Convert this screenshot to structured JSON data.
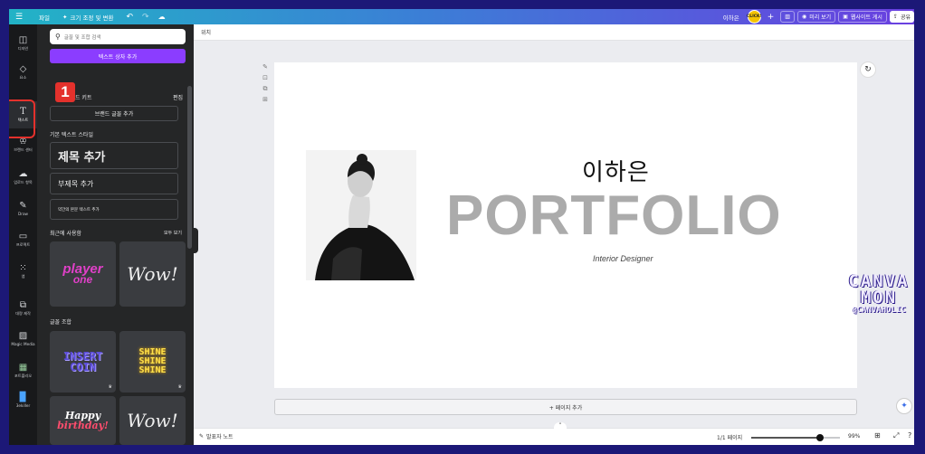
{
  "topbar": {
    "menu_icon": "hamburger-icon",
    "file": "파일",
    "resize": "크기 조정 및 변환",
    "undo_icon": "undo-icon",
    "redo_icon": "redo-icon",
    "cloud_icon": "cloud-icon",
    "user_name": "이하은",
    "avatar_text": "CLICK!",
    "add": "+",
    "stats_icon": "chart-icon",
    "preview": "미리 보기",
    "publish": "웹사이트 게시",
    "share": "공유"
  },
  "rail": [
    {
      "label": "디자인",
      "icon": "design-icon"
    },
    {
      "label": "요소",
      "icon": "elements-icon"
    },
    {
      "label": "텍스트",
      "icon": "text-icon"
    },
    {
      "label": "브랜드 센터",
      "icon": "brand-icon"
    },
    {
      "label": "업로드 항목",
      "icon": "upload-icon"
    },
    {
      "label": "Draw",
      "icon": "draw-icon"
    },
    {
      "label": "프로젝트",
      "icon": "folder-icon"
    },
    {
      "label": "앱",
      "icon": "apps-icon"
    },
    {
      "label": "대량 제작",
      "icon": "bulk-create-icon"
    },
    {
      "label": "Magic Media",
      "icon": "magic-media-icon"
    },
    {
      "label": "포트폴리오",
      "icon": "portfolio-icon"
    },
    {
      "label": "3ekiller",
      "icon": "app-tile-icon"
    }
  ],
  "panel": {
    "search_placeholder": "글꼴 및 조합 검색",
    "add_textbox": "텍스트 상자 추가",
    "badge": "1",
    "brand_kit": "드 키트",
    "edit": "편집",
    "add_brand_font": "브랜드 글꼴 추가",
    "default_styles": "기본 텍스트 스타일",
    "heading": "제목 추가",
    "subheading": "부제목 추가",
    "body": "약간의 본문 텍스트 추가",
    "recent": "최근에 사용함",
    "see_all": "모두 보기",
    "combos": "글꼴 조합",
    "tiles": {
      "player_one_1": "player",
      "player_one_2": "one",
      "wow": "Wow!",
      "insert_1": "INSERT",
      "insert_2": "COIN",
      "shine_1": "SHINE",
      "shine_2": "SHINE",
      "shine_3": "SHINE",
      "happy_1": "Happy",
      "happy_2": "birthday!",
      "wow2": "Wow!"
    }
  },
  "canvas": {
    "position_label": "위치",
    "signature": "이하은",
    "title": "PORTFOLIO",
    "subtitle": "Interior Designer",
    "add_page": "+ 페이지 추가"
  },
  "bottombar": {
    "notes": "발표자 노트",
    "page_count": "1/1 페이지",
    "zoom": "99%",
    "zoom_level": 0.99
  },
  "watermark": {
    "line1": "CANVA",
    "line2": "MON",
    "line3": "@CANVAHOLIC"
  },
  "colors": {
    "accent": "#8b3dff",
    "highlight": "#e4312c",
    "title_gray": "#ababab"
  }
}
